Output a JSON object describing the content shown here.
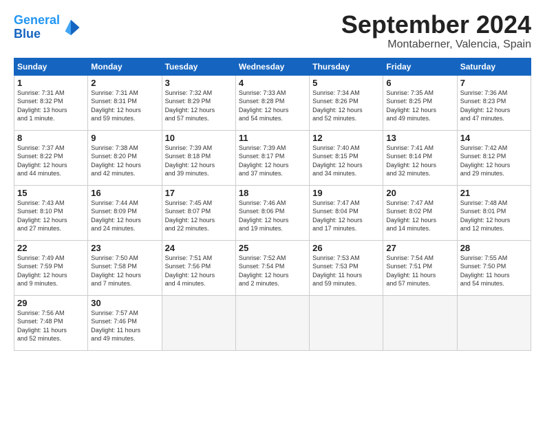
{
  "logo": {
    "line1": "General",
    "line2": "Blue"
  },
  "title": "September 2024",
  "subtitle": "Montaberner, Valencia, Spain",
  "days_header": [
    "Sunday",
    "Monday",
    "Tuesday",
    "Wednesday",
    "Thursday",
    "Friday",
    "Saturday"
  ],
  "weeks": [
    [
      {
        "num": "1",
        "detail": "Sunrise: 7:31 AM\nSunset: 8:32 PM\nDaylight: 13 hours\nand 1 minute."
      },
      {
        "num": "2",
        "detail": "Sunrise: 7:31 AM\nSunset: 8:31 PM\nDaylight: 12 hours\nand 59 minutes."
      },
      {
        "num": "3",
        "detail": "Sunrise: 7:32 AM\nSunset: 8:29 PM\nDaylight: 12 hours\nand 57 minutes."
      },
      {
        "num": "4",
        "detail": "Sunrise: 7:33 AM\nSunset: 8:28 PM\nDaylight: 12 hours\nand 54 minutes."
      },
      {
        "num": "5",
        "detail": "Sunrise: 7:34 AM\nSunset: 8:26 PM\nDaylight: 12 hours\nand 52 minutes."
      },
      {
        "num": "6",
        "detail": "Sunrise: 7:35 AM\nSunset: 8:25 PM\nDaylight: 12 hours\nand 49 minutes."
      },
      {
        "num": "7",
        "detail": "Sunrise: 7:36 AM\nSunset: 8:23 PM\nDaylight: 12 hours\nand 47 minutes."
      }
    ],
    [
      {
        "num": "8",
        "detail": "Sunrise: 7:37 AM\nSunset: 8:22 PM\nDaylight: 12 hours\nand 44 minutes."
      },
      {
        "num": "9",
        "detail": "Sunrise: 7:38 AM\nSunset: 8:20 PM\nDaylight: 12 hours\nand 42 minutes."
      },
      {
        "num": "10",
        "detail": "Sunrise: 7:39 AM\nSunset: 8:18 PM\nDaylight: 12 hours\nand 39 minutes."
      },
      {
        "num": "11",
        "detail": "Sunrise: 7:39 AM\nSunset: 8:17 PM\nDaylight: 12 hours\nand 37 minutes."
      },
      {
        "num": "12",
        "detail": "Sunrise: 7:40 AM\nSunset: 8:15 PM\nDaylight: 12 hours\nand 34 minutes."
      },
      {
        "num": "13",
        "detail": "Sunrise: 7:41 AM\nSunset: 8:14 PM\nDaylight: 12 hours\nand 32 minutes."
      },
      {
        "num": "14",
        "detail": "Sunrise: 7:42 AM\nSunset: 8:12 PM\nDaylight: 12 hours\nand 29 minutes."
      }
    ],
    [
      {
        "num": "15",
        "detail": "Sunrise: 7:43 AM\nSunset: 8:10 PM\nDaylight: 12 hours\nand 27 minutes."
      },
      {
        "num": "16",
        "detail": "Sunrise: 7:44 AM\nSunset: 8:09 PM\nDaylight: 12 hours\nand 24 minutes."
      },
      {
        "num": "17",
        "detail": "Sunrise: 7:45 AM\nSunset: 8:07 PM\nDaylight: 12 hours\nand 22 minutes."
      },
      {
        "num": "18",
        "detail": "Sunrise: 7:46 AM\nSunset: 8:06 PM\nDaylight: 12 hours\nand 19 minutes."
      },
      {
        "num": "19",
        "detail": "Sunrise: 7:47 AM\nSunset: 8:04 PM\nDaylight: 12 hours\nand 17 minutes."
      },
      {
        "num": "20",
        "detail": "Sunrise: 7:47 AM\nSunset: 8:02 PM\nDaylight: 12 hours\nand 14 minutes."
      },
      {
        "num": "21",
        "detail": "Sunrise: 7:48 AM\nSunset: 8:01 PM\nDaylight: 12 hours\nand 12 minutes."
      }
    ],
    [
      {
        "num": "22",
        "detail": "Sunrise: 7:49 AM\nSunset: 7:59 PM\nDaylight: 12 hours\nand 9 minutes."
      },
      {
        "num": "23",
        "detail": "Sunrise: 7:50 AM\nSunset: 7:58 PM\nDaylight: 12 hours\nand 7 minutes."
      },
      {
        "num": "24",
        "detail": "Sunrise: 7:51 AM\nSunset: 7:56 PM\nDaylight: 12 hours\nand 4 minutes."
      },
      {
        "num": "25",
        "detail": "Sunrise: 7:52 AM\nSunset: 7:54 PM\nDaylight: 12 hours\nand 2 minutes."
      },
      {
        "num": "26",
        "detail": "Sunrise: 7:53 AM\nSunset: 7:53 PM\nDaylight: 11 hours\nand 59 minutes."
      },
      {
        "num": "27",
        "detail": "Sunrise: 7:54 AM\nSunset: 7:51 PM\nDaylight: 11 hours\nand 57 minutes."
      },
      {
        "num": "28",
        "detail": "Sunrise: 7:55 AM\nSunset: 7:50 PM\nDaylight: 11 hours\nand 54 minutes."
      }
    ],
    [
      {
        "num": "29",
        "detail": "Sunrise: 7:56 AM\nSunset: 7:48 PM\nDaylight: 11 hours\nand 52 minutes."
      },
      {
        "num": "30",
        "detail": "Sunrise: 7:57 AM\nSunset: 7:46 PM\nDaylight: 11 hours\nand 49 minutes."
      },
      {
        "num": "",
        "detail": ""
      },
      {
        "num": "",
        "detail": ""
      },
      {
        "num": "",
        "detail": ""
      },
      {
        "num": "",
        "detail": ""
      },
      {
        "num": "",
        "detail": ""
      }
    ]
  ]
}
